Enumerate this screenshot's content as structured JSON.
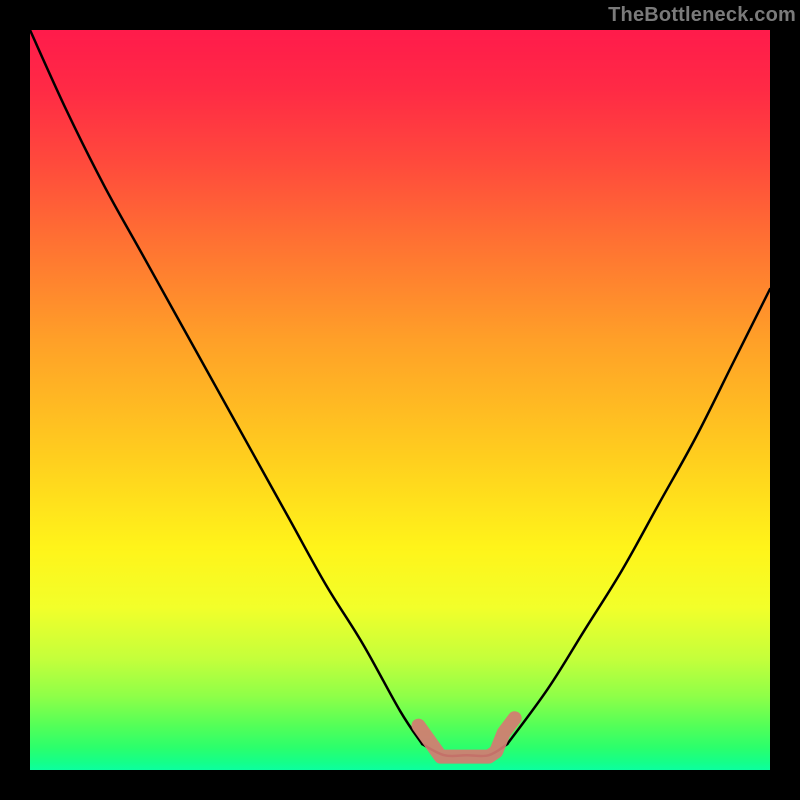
{
  "watermark": "TheBottleneck.com",
  "chart_data": {
    "type": "line",
    "title": "",
    "xlabel": "",
    "ylabel": "",
    "xlim": [
      0,
      1
    ],
    "ylim": [
      0,
      1
    ],
    "series": [
      {
        "name": "left-branch",
        "x": [
          0.0,
          0.05,
          0.1,
          0.15,
          0.2,
          0.25,
          0.3,
          0.35,
          0.4,
          0.45,
          0.5,
          0.53
        ],
        "values": [
          1.0,
          0.89,
          0.79,
          0.7,
          0.61,
          0.52,
          0.43,
          0.34,
          0.25,
          0.17,
          0.08,
          0.035
        ]
      },
      {
        "name": "flat-bottom",
        "x": [
          0.53,
          0.56,
          0.59,
          0.62,
          0.645
        ],
        "values": [
          0.035,
          0.02,
          0.02,
          0.02,
          0.035
        ]
      },
      {
        "name": "right-branch",
        "x": [
          0.645,
          0.7,
          0.75,
          0.8,
          0.85,
          0.9,
          0.95,
          1.0
        ],
        "values": [
          0.035,
          0.11,
          0.19,
          0.27,
          0.36,
          0.45,
          0.55,
          0.65
        ]
      },
      {
        "name": "thick-marker-overlay",
        "x": [
          0.525,
          0.55,
          0.555,
          0.56,
          0.58,
          0.6,
          0.62,
          0.63,
          0.64,
          0.655
        ],
        "values": [
          0.06,
          0.025,
          0.018,
          0.018,
          0.018,
          0.018,
          0.018,
          0.025,
          0.05,
          0.07
        ]
      }
    ],
    "colors": {
      "curve": "#000000",
      "marker": "#d57b72"
    },
    "annotations": []
  }
}
